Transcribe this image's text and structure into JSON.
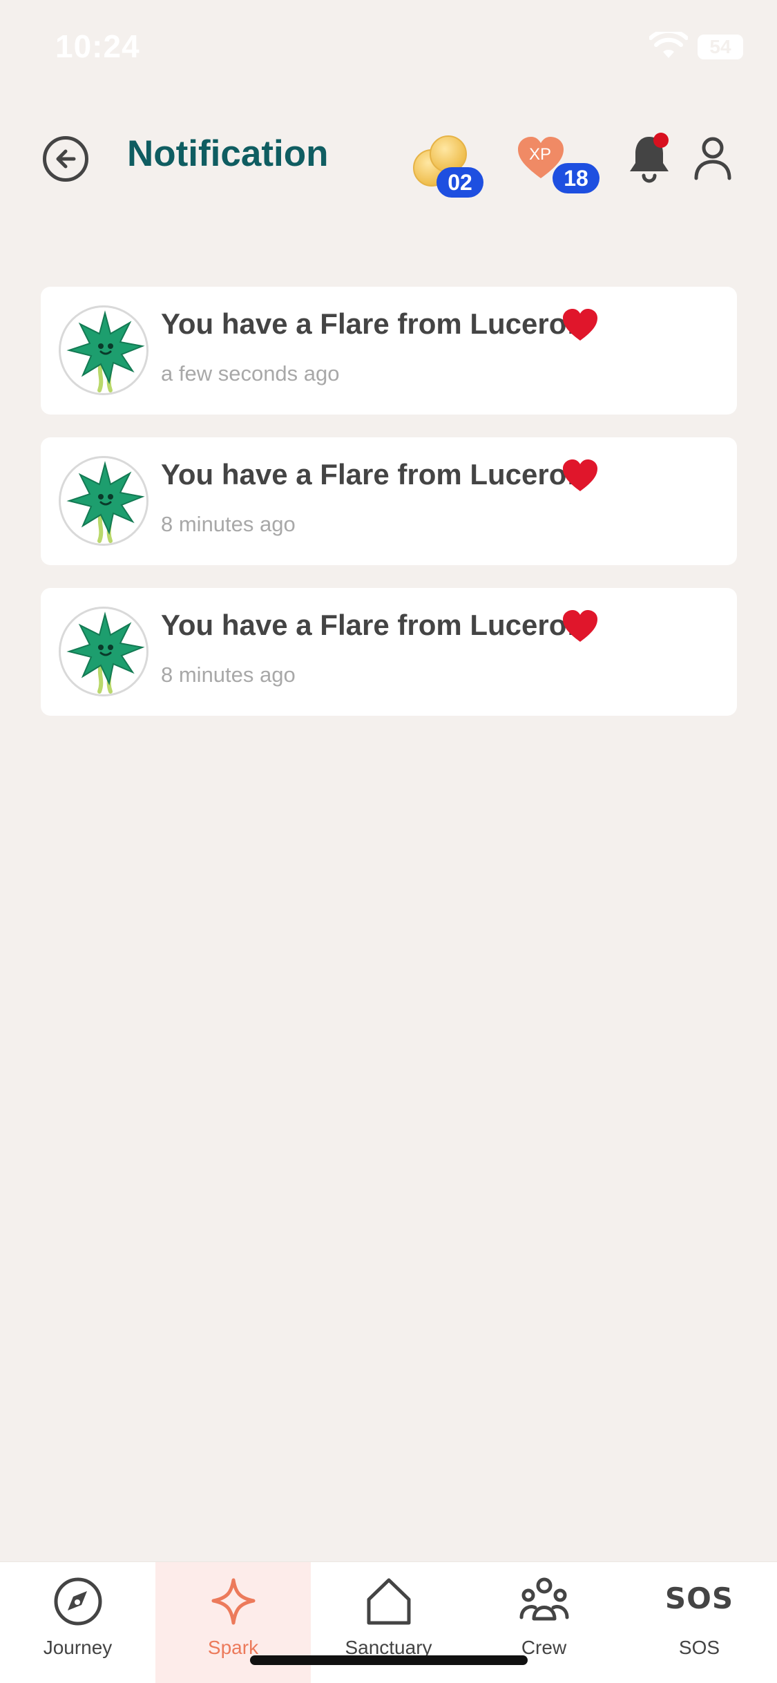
{
  "status_bar": {
    "time": "10:24",
    "battery": "54"
  },
  "header": {
    "title": "Notification",
    "coins_count": "02",
    "xp_label": "XP",
    "xp_count": "18"
  },
  "notifications": [
    {
      "message": "You have a Flare from Lucero!",
      "time": "a few seconds ago"
    },
    {
      "message": "You have a Flare from Lucero!",
      "time": "8 minutes ago"
    },
    {
      "message": "You have a Flare from Lucero!",
      "time": "8 minutes ago"
    }
  ],
  "nav": {
    "items": [
      {
        "label": "Journey",
        "icon": "compass-icon"
      },
      {
        "label": "Spark",
        "icon": "sparkle-icon",
        "active": true
      },
      {
        "label": "Sanctuary",
        "icon": "home-icon"
      },
      {
        "label": "Crew",
        "icon": "group-icon"
      },
      {
        "label": "SOS",
        "icon": "sos-icon",
        "mark": "SOS"
      }
    ]
  },
  "colors": {
    "background": "#f4f0ed",
    "title": "#0f5d61",
    "badge": "#1e4fe0",
    "accent": "#ec7a5b",
    "notification_dot": "#d8101f"
  }
}
